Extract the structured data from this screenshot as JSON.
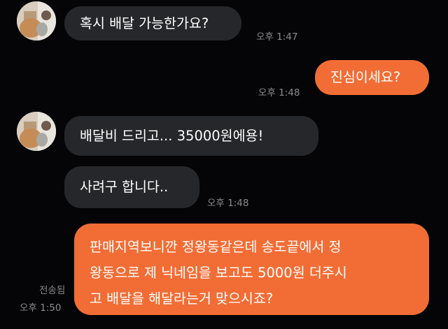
{
  "messages": [
    {
      "id": "m1",
      "side": "received",
      "text": "혹시 배달 가능한가요?",
      "time": "오후 1:47"
    },
    {
      "id": "m2",
      "side": "sent",
      "text": "진심이세요?",
      "time": "오후 1:48"
    },
    {
      "id": "m3",
      "side": "received",
      "text": "배달비 드리고... 35000원에용!"
    },
    {
      "id": "m4",
      "side": "received",
      "text": "사려구 합니다..",
      "time": "오후 1:48"
    },
    {
      "id": "m5",
      "side": "sent",
      "lines": [
        "판매지역보니깐 정왕동같은데 송도끝에서 정",
        "왕동으로 제 닉네임을 보고도 5000원 더주시",
        "고 배달을 해달라는거 맞으시죠?"
      ],
      "status": "전송됨",
      "time": "오후 1:50"
    }
  ],
  "colors": {
    "background": "#050507",
    "received_bubble": "#26272b",
    "sent_bubble": "#f26d35",
    "meta_text": "#8a8b8f"
  }
}
